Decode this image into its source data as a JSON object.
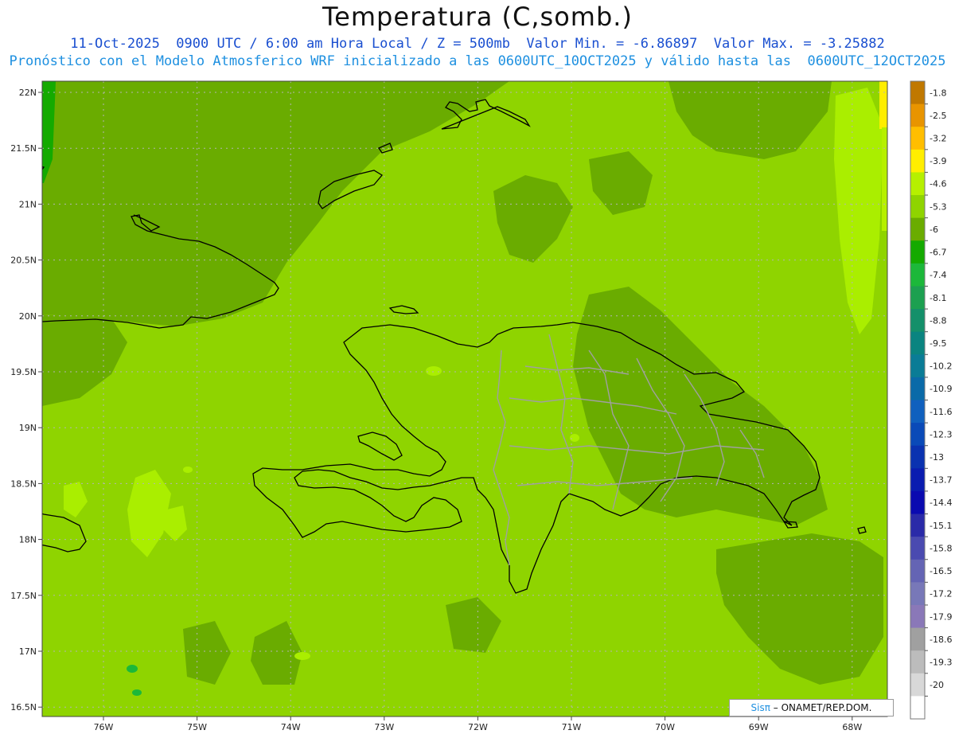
{
  "title": "Temperatura (C,somb.)",
  "subtitle_line1": "11-Oct-2025  0900 UTC / 6:00 am Hora Local / Z = 500mb  Valor Min. = -6.86897  Valor Max. = -3.25882",
  "subtitle_line2": "Pronóstico con el Modelo Atmosferico WRF inicializado a las 0600UTC_10OCT2025 y válido hasta las  0600UTC_12OCT2025",
  "map": {
    "lat_labels": [
      "22N",
      "21.5N",
      "21N",
      "20.5N",
      "20N",
      "19.5N",
      "19N",
      "18.5N",
      "18N",
      "17.5N",
      "17N",
      "16.5N"
    ],
    "lon_labels": [
      "76W",
      "75W",
      "74W",
      "73W",
      "72W",
      "71W",
      "70W",
      "69W",
      "68W"
    ],
    "background_color": "#8fd400",
    "dark_shade_color": "#6aac00",
    "light_shade_color": "#aaee00"
  },
  "colorbar": {
    "labels": [
      "-1.8",
      "-2.5",
      "-3.2",
      "-3.9",
      "-4.6",
      "-5.3",
      "-6",
      "-6.7",
      "-7.4",
      "-8.1",
      "-8.8",
      "-9.5",
      "-10.2",
      "-10.9",
      "-11.6",
      "-12.3",
      "-13",
      "-13.7",
      "-14.4",
      "-15.1",
      "-15.8",
      "-16.5",
      "-17.2",
      "-17.9",
      "-18.6",
      "-19.3",
      "-20"
    ],
    "colors": [
      "#c07800",
      "#e89400",
      "#ffbe00",
      "#ffee00",
      "#b6f000",
      "#8fd400",
      "#6aac00",
      "#14aa00",
      "#1cb83a",
      "#1ca050",
      "#14906a",
      "#0a8480",
      "#0a7c96",
      "#0a6aa8",
      "#1060be",
      "#0a4ab8",
      "#0a32b0",
      "#0a1cb0",
      "#0a0ab0",
      "#2a2aa8",
      "#4a4ab0",
      "#6464b4",
      "#7878b8",
      "#8a78b8",
      "#a0a0a0",
      "#bcbcbc",
      "#d8d8d8",
      "#ffffff"
    ]
  },
  "credit": {
    "brand": "Sisπ",
    "text": " – ONAMET/REP.DOM."
  }
}
